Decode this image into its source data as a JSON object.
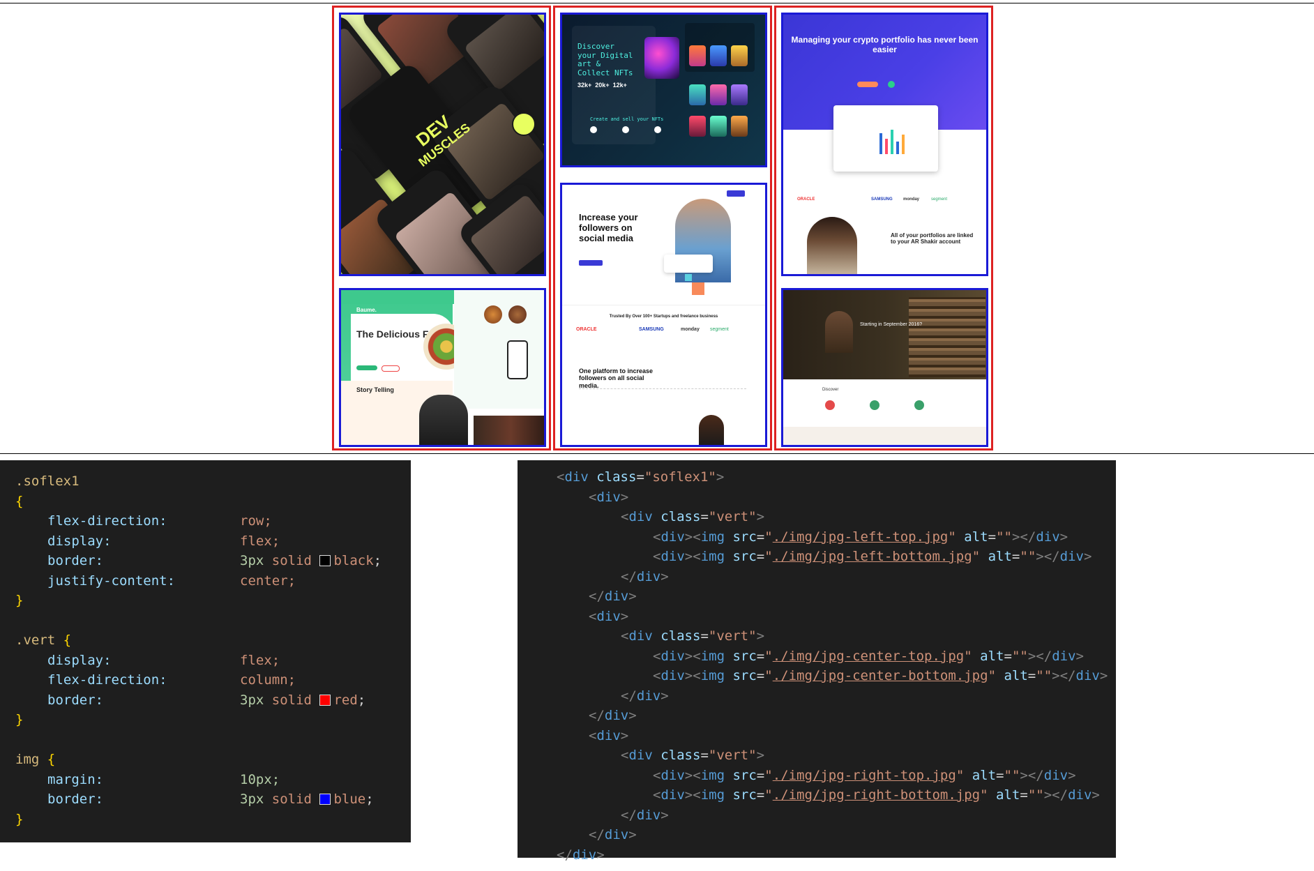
{
  "colors": {
    "column_border": "#d22222",
    "image_border": "#1a1ad6",
    "black": "#000000",
    "red": "#ff0000",
    "blue": "#0000ff"
  },
  "thumbnails": {
    "left_top": {
      "brand_line1": "DEV",
      "brand_line2": "MUSCLES"
    },
    "left_bottom": {
      "heading": "The Delicious Food House",
      "story": "Story Telling",
      "logo": "Baume."
    },
    "center_top": {
      "heading": "Discover your Digital art & Collect NFTs",
      "stat1": "32k+",
      "stat2": "20k+",
      "stat3": "12k+",
      "section": "Create and sell your NFTs"
    },
    "center_bottom": {
      "heading": "Increase your followers on social media",
      "trusted": "Trusted By Over 100+ Startups and freelance business",
      "sub": "One platform to increase followers on all social media.",
      "brands": [
        "ORACLE",
        "SAMSUNG",
        "monday",
        "segment"
      ]
    },
    "right_top": {
      "heading": "Managing your crypto portfolio has never been easier",
      "sub": "All of your portfolios are linked to your AR Shakir account",
      "brands": [
        "ORACLE",
        "SAMSUNG",
        "monday",
        "segment"
      ]
    },
    "right_bottom": {
      "heading": "Starting in September 2016?",
      "section": "Discover"
    }
  },
  "css_code": {
    "lines": [
      {
        "type": "selector",
        "text": ".soflex1"
      },
      {
        "type": "brace",
        "text": "{"
      },
      {
        "type": "decl",
        "prop": "flex-direction:",
        "value": "row;"
      },
      {
        "type": "decl",
        "prop": "display:",
        "value": "flex;"
      },
      {
        "type": "border",
        "prop": "border:",
        "size": "3px",
        "style": "solid",
        "color_name": "black",
        "swatch": "#000000"
      },
      {
        "type": "decl",
        "prop": "justify-content:",
        "value": "center;"
      },
      {
        "type": "brace",
        "text": "}"
      },
      {
        "type": "blank"
      },
      {
        "type": "selector_brace",
        "text": ".vert",
        "brace": "{"
      },
      {
        "type": "decl",
        "prop": "display:",
        "value": "flex;"
      },
      {
        "type": "decl",
        "prop": "flex-direction:",
        "value": "column;"
      },
      {
        "type": "border",
        "prop": "border:",
        "size": "3px",
        "style": "solid",
        "color_name": "red",
        "swatch": "#ff0000"
      },
      {
        "type": "brace",
        "text": "}"
      },
      {
        "type": "blank"
      },
      {
        "type": "selector_brace",
        "text": "img",
        "brace": "{"
      },
      {
        "type": "decl_num",
        "prop": "margin:",
        "value": "10px;"
      },
      {
        "type": "border",
        "prop": "border:",
        "size": "3px",
        "style": "solid",
        "color_name": "blue",
        "swatch": "#0000ff"
      },
      {
        "type": "brace",
        "text": "}"
      }
    ]
  },
  "html_code": {
    "lines": [
      "<div class=\"soflex1\">",
      "<div>",
      "<div class=\"vert\">",
      "<div><img src=\"./img/jpg-left-top.jpg\" alt=\"\"></div>",
      "<div><img src=\"./img/jpg-left-bottom.jpg\" alt=\"\"></div>",
      "</div>",
      "</div>",
      "<div>",
      "<div class=\"vert\">",
      "<div><img src=\"./img/jpg-center-top.jpg\" alt=\"\"></div>",
      "<div><img src=\"./img/jpg-center-bottom.jpg\" alt=\"\"></div>",
      "</div>",
      "</div>",
      "<div>",
      "<div class=\"vert\">",
      "<div><img src=\"./img/jpg-right-top.jpg\" alt=\"\"></div>",
      "<div><img src=\"./img/jpg-right-bottom.jpg\" alt=\"\"></div>",
      "</div>",
      "</div>",
      "</div>"
    ],
    "indents": [
      0,
      1,
      2,
      3,
      3,
      2,
      1,
      1,
      2,
      3,
      3,
      2,
      1,
      1,
      2,
      3,
      3,
      2,
      1,
      0
    ]
  }
}
